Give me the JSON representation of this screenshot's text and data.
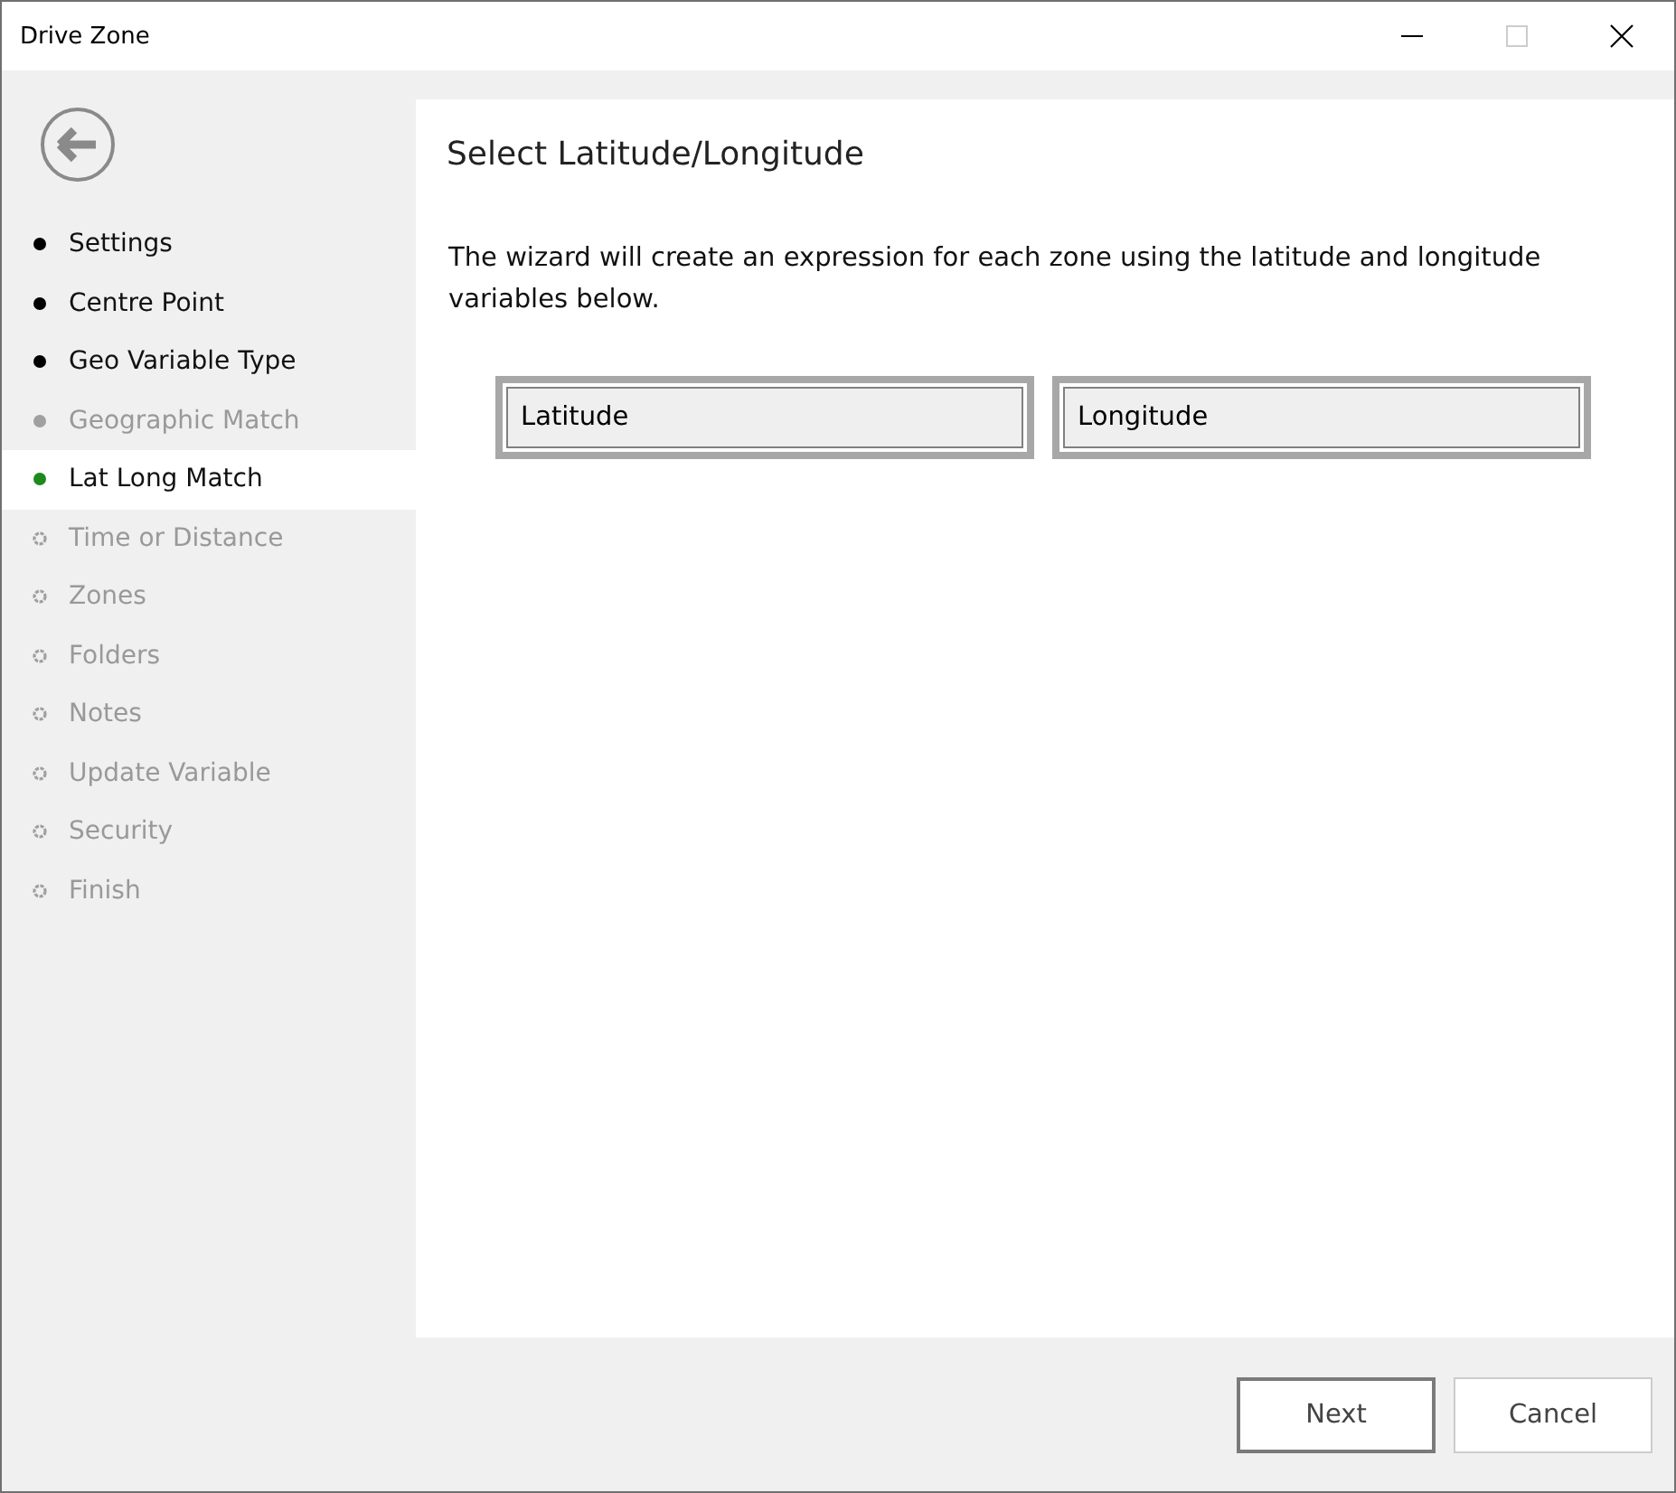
{
  "window": {
    "title": "Drive Zone",
    "maximize_disabled": true
  },
  "steps": [
    {
      "label": "Settings",
      "kind": "done",
      "selected": false
    },
    {
      "label": "Centre Point",
      "kind": "done",
      "selected": false
    },
    {
      "label": "Geo Variable Type",
      "kind": "done",
      "selected": false
    },
    {
      "label": "Geographic Match",
      "kind": "skipped",
      "selected": false
    },
    {
      "label": "Lat Long Match",
      "kind": "current",
      "selected": true
    },
    {
      "label": "Time or Distance",
      "kind": "pending",
      "selected": false
    },
    {
      "label": "Zones",
      "kind": "pending",
      "selected": false
    },
    {
      "label": "Folders",
      "kind": "pending",
      "selected": false
    },
    {
      "label": "Notes",
      "kind": "pending",
      "selected": false
    },
    {
      "label": "Update Variable",
      "kind": "pending",
      "selected": false
    },
    {
      "label": "Security",
      "kind": "pending",
      "selected": false
    },
    {
      "label": "Finish",
      "kind": "pending",
      "selected": false
    }
  ],
  "page": {
    "heading": "Select Latitude/Longitude",
    "description": "The wizard will create an expression for each zone using the latitude and longitude variables  below.",
    "fields": [
      {
        "label": "Latitude"
      },
      {
        "label": "Longitude"
      }
    ]
  },
  "buttons": [
    {
      "label": "Next",
      "default": true
    },
    {
      "label": "Cancel",
      "default": false
    }
  ]
}
